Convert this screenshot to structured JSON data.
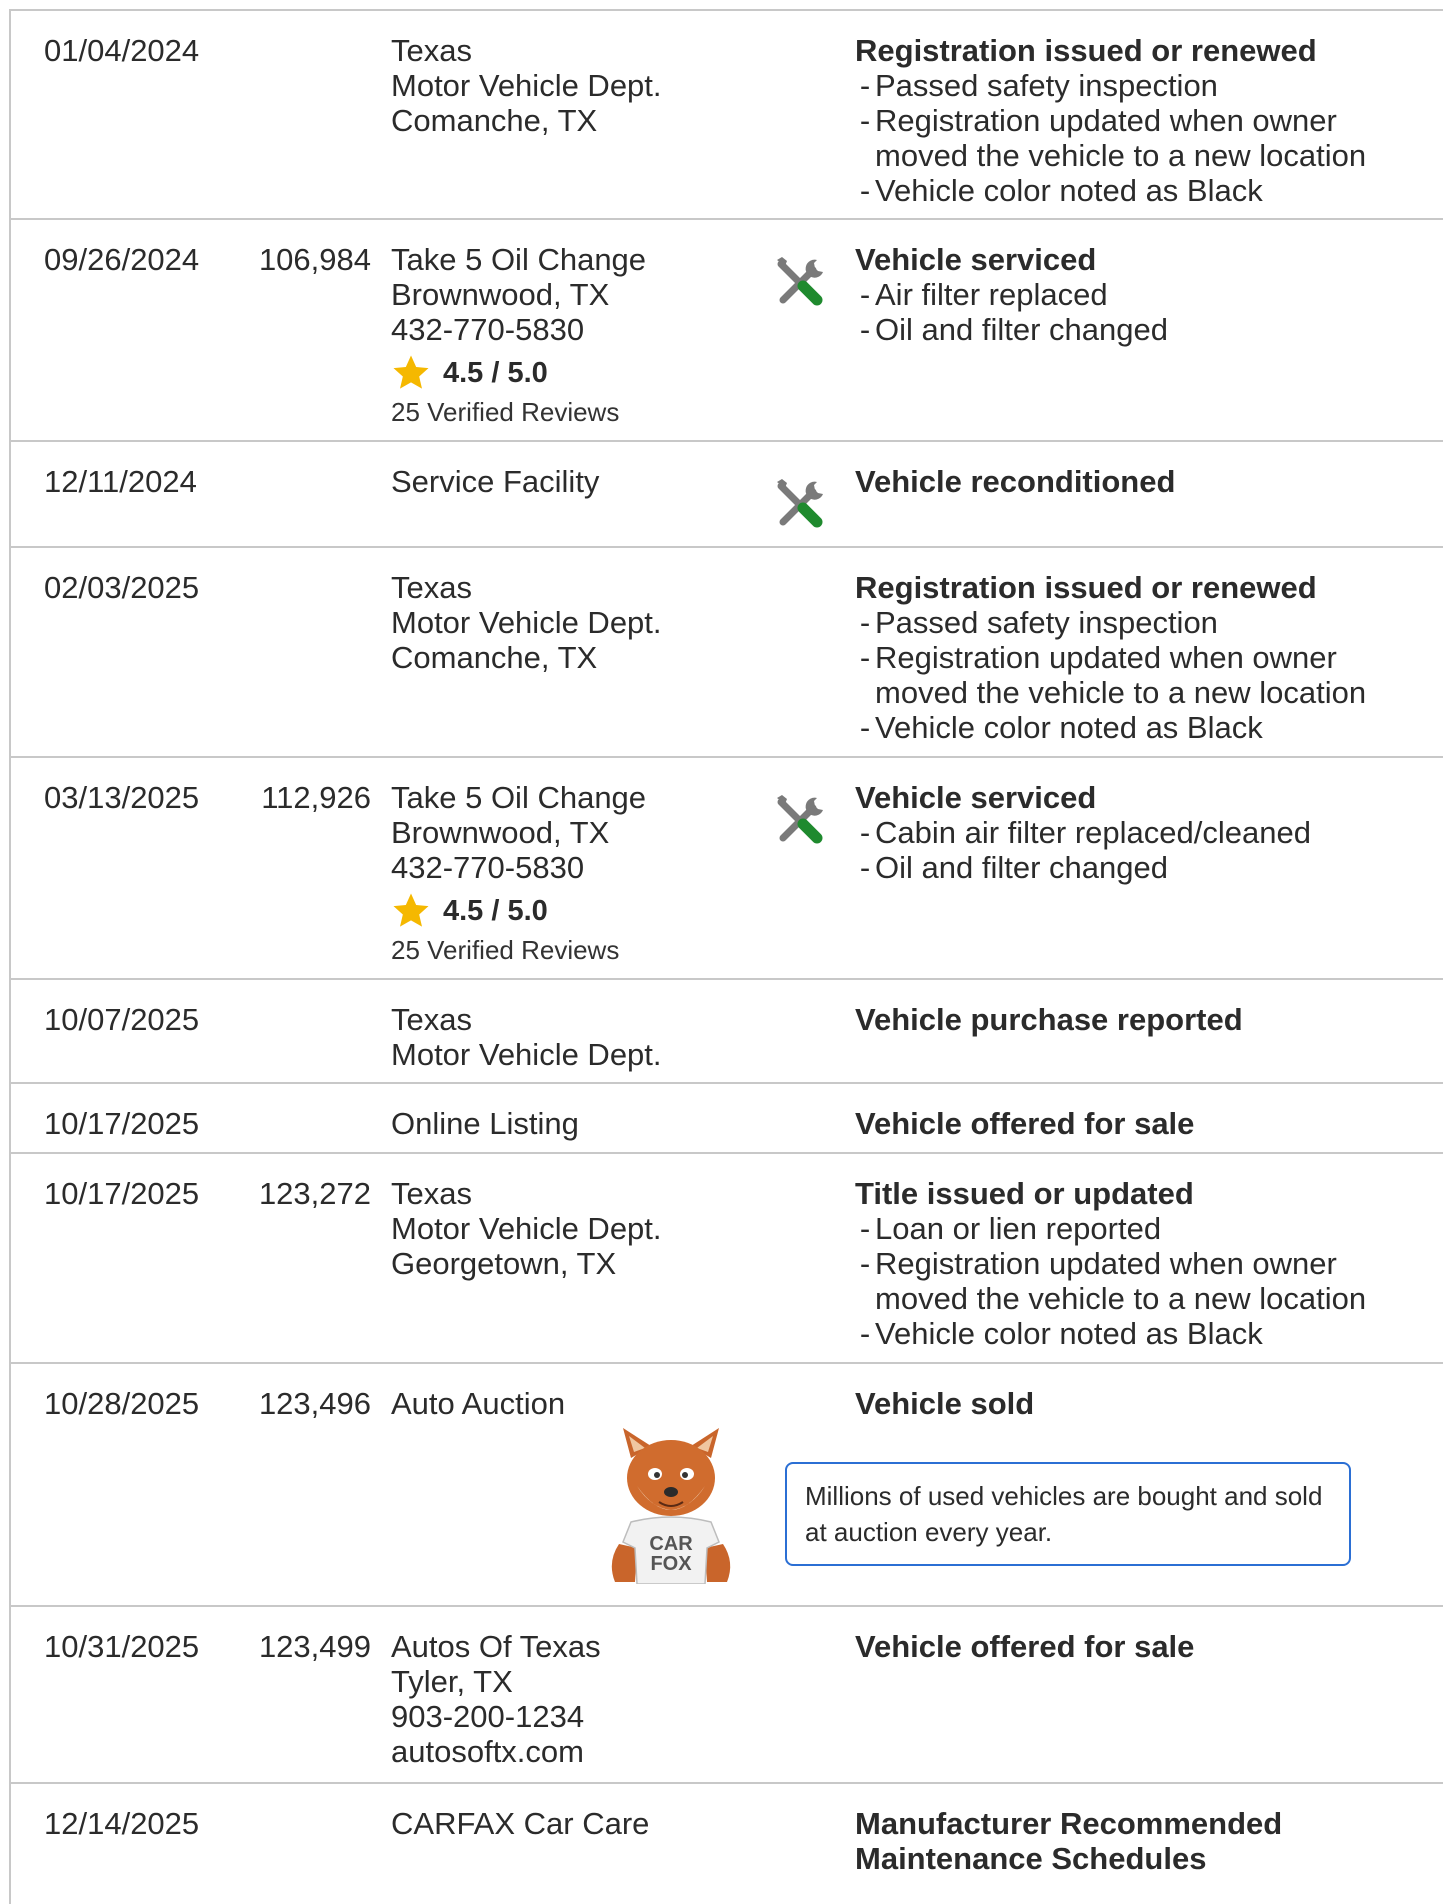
{
  "rows": [
    {
      "date": "01/04/2024",
      "odometer": "",
      "source": [
        "Texas",
        "Motor Vehicle Dept.",
        "Comanche, TX"
      ],
      "title": "Registration issued or renewed",
      "items": [
        "Passed safety inspection",
        "Registration updated when owner moved the vehicle to a new location",
        "Vehicle color noted as Black"
      ]
    },
    {
      "date": "09/26/2024",
      "odometer": "106,984",
      "source": [
        "Take 5 Oil Change",
        "Brownwood, TX",
        "432-770-5830"
      ],
      "rating": "4.5 / 5.0",
      "reviews": "25 Verified Reviews",
      "title": "Vehicle serviced",
      "items": [
        "Air filter replaced",
        "Oil and filter changed"
      ]
    },
    {
      "date": "12/11/2024",
      "odometer": "",
      "source": [
        "Service Facility"
      ],
      "title": "Vehicle reconditioned",
      "items": []
    },
    {
      "date": "02/03/2025",
      "odometer": "",
      "source": [
        "Texas",
        "Motor Vehicle Dept.",
        "Comanche, TX"
      ],
      "title": "Registration issued or renewed",
      "items": [
        "Passed safety inspection",
        "Registration updated when owner moved the vehicle to a new location",
        "Vehicle color noted as Black"
      ]
    },
    {
      "date": "03/13/2025",
      "odometer": "112,926",
      "source": [
        "Take 5 Oil Change",
        "Brownwood, TX",
        "432-770-5830"
      ],
      "rating": "4.5 / 5.0",
      "reviews": "25 Verified Reviews",
      "title": "Vehicle serviced",
      "items": [
        "Cabin air filter replaced/cleaned",
        "Oil and filter changed"
      ]
    },
    {
      "date": "10/07/2025",
      "odometer": "",
      "source": [
        "Texas",
        "Motor Vehicle Dept."
      ],
      "title": "Vehicle purchase reported",
      "items": []
    },
    {
      "date": "10/17/2025",
      "odometer": "",
      "source": [
        "Online Listing"
      ],
      "title": "Vehicle offered for sale",
      "items": []
    },
    {
      "date": "10/17/2025",
      "odometer": "123,272",
      "source": [
        "Texas",
        "Motor Vehicle Dept.",
        "Georgetown, TX"
      ],
      "title": "Title issued or updated",
      "items": [
        "Loan or lien reported",
        "Registration updated when owner moved the vehicle to a new location",
        "Vehicle color noted as Black"
      ]
    },
    {
      "date": "10/28/2025",
      "odometer": "123,496",
      "source": [
        "Auto Auction"
      ],
      "title": "Vehicle sold",
      "items": [],
      "callout": "Millions of used vehicles are bought and sold at auction every year.",
      "fox_text": [
        "CAR",
        "FOX"
      ]
    },
    {
      "date": "10/31/2025",
      "odometer": "123,499",
      "source": [
        "Autos Of Texas",
        "Tyler, TX",
        "903-200-1234",
        "autosoftx.com"
      ],
      "title": "Vehicle offered for sale",
      "items": []
    },
    {
      "date": "12/14/2025",
      "odometer": "",
      "source": [
        "CARFAX Car Care"
      ],
      "title": "Manufacturer Recommended Maintenance Schedules",
      "items": []
    }
  ],
  "colors": {
    "border": "#c8c8c8",
    "star": "#f5b800",
    "tool_green": "#1f8a2e",
    "tool_gray": "#7a7a7a",
    "callout_border": "#2b6fd4"
  },
  "icons": {
    "service": "wrench-screwdriver-icon",
    "rating": "star-icon",
    "mascot": "carfox-mascot"
  }
}
